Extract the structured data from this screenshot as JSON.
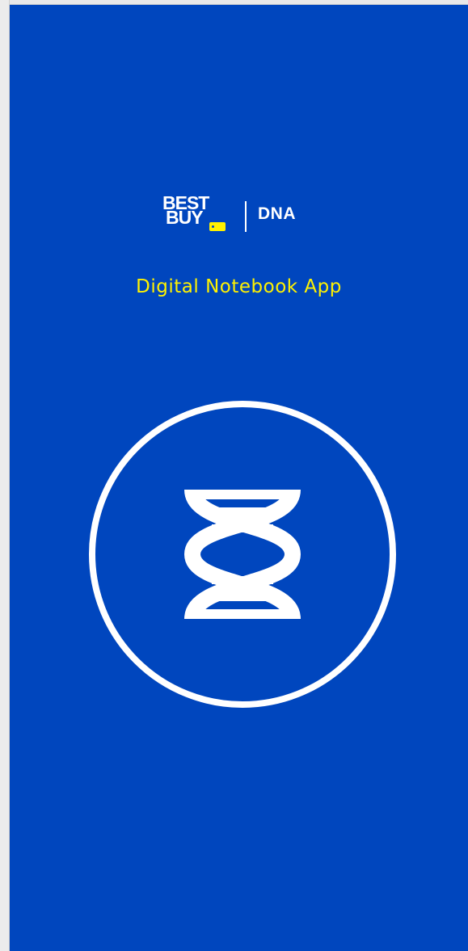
{
  "brand": {
    "logo_line1": "BEST",
    "logo_line2": "BUY",
    "product": "DNA"
  },
  "app": {
    "title": "Digital Notebook App"
  },
  "icons": {
    "emblem": "dna-helix-icon"
  },
  "colors": {
    "background": "#0046be",
    "accent_yellow": "#fff200",
    "foreground": "#ffffff"
  }
}
